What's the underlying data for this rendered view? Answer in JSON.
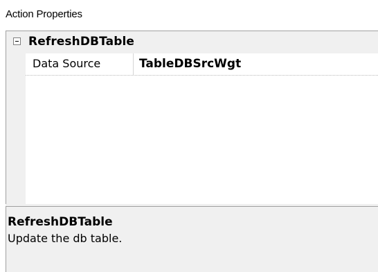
{
  "panel": {
    "title": "Action Properties"
  },
  "grid": {
    "category": {
      "label": "RefreshDBTable",
      "expanded": true,
      "toggle_icon": "minus-box-icon"
    },
    "properties": [
      {
        "name": "Data Source",
        "value": "TableDBSrcWgt"
      }
    ]
  },
  "description": {
    "title": "RefreshDBTable",
    "text": "Update the db table."
  }
}
